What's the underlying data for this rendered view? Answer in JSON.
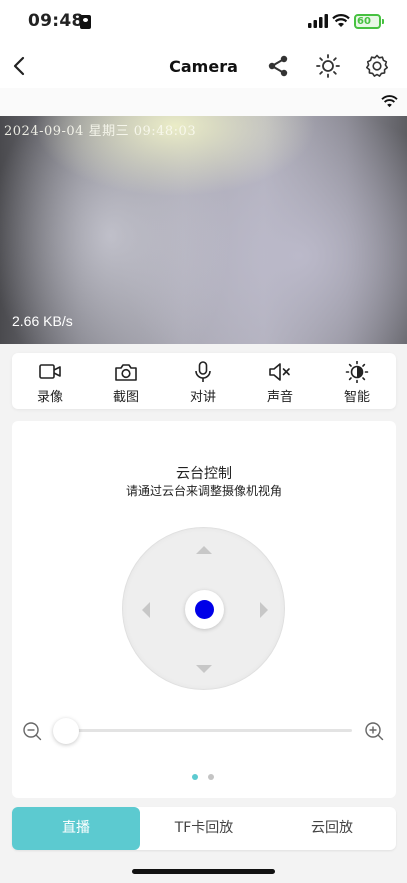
{
  "status_bar": {
    "time": "09:48",
    "battery": "60"
  },
  "nav": {
    "title": "Camera"
  },
  "video": {
    "timestamp": "2024-09-04 星期三 09:48:03",
    "speed": "2.66 KB/s"
  },
  "toolbar": {
    "record": "录像",
    "screenshot": "截图",
    "talk": "对讲",
    "sound": "声音",
    "smart": "智能"
  },
  "ptz": {
    "title": "云台控制",
    "subtitle": "请通过云台来调整摄像机视角",
    "zoom_level": 0
  },
  "tabs": {
    "live": "直播",
    "tf_playback": "TF卡回放",
    "cloud_playback": "云回放"
  },
  "colors": {
    "accent": "#5ccad0",
    "joystick_knob": "#0000e8",
    "battery": "#47c141"
  }
}
